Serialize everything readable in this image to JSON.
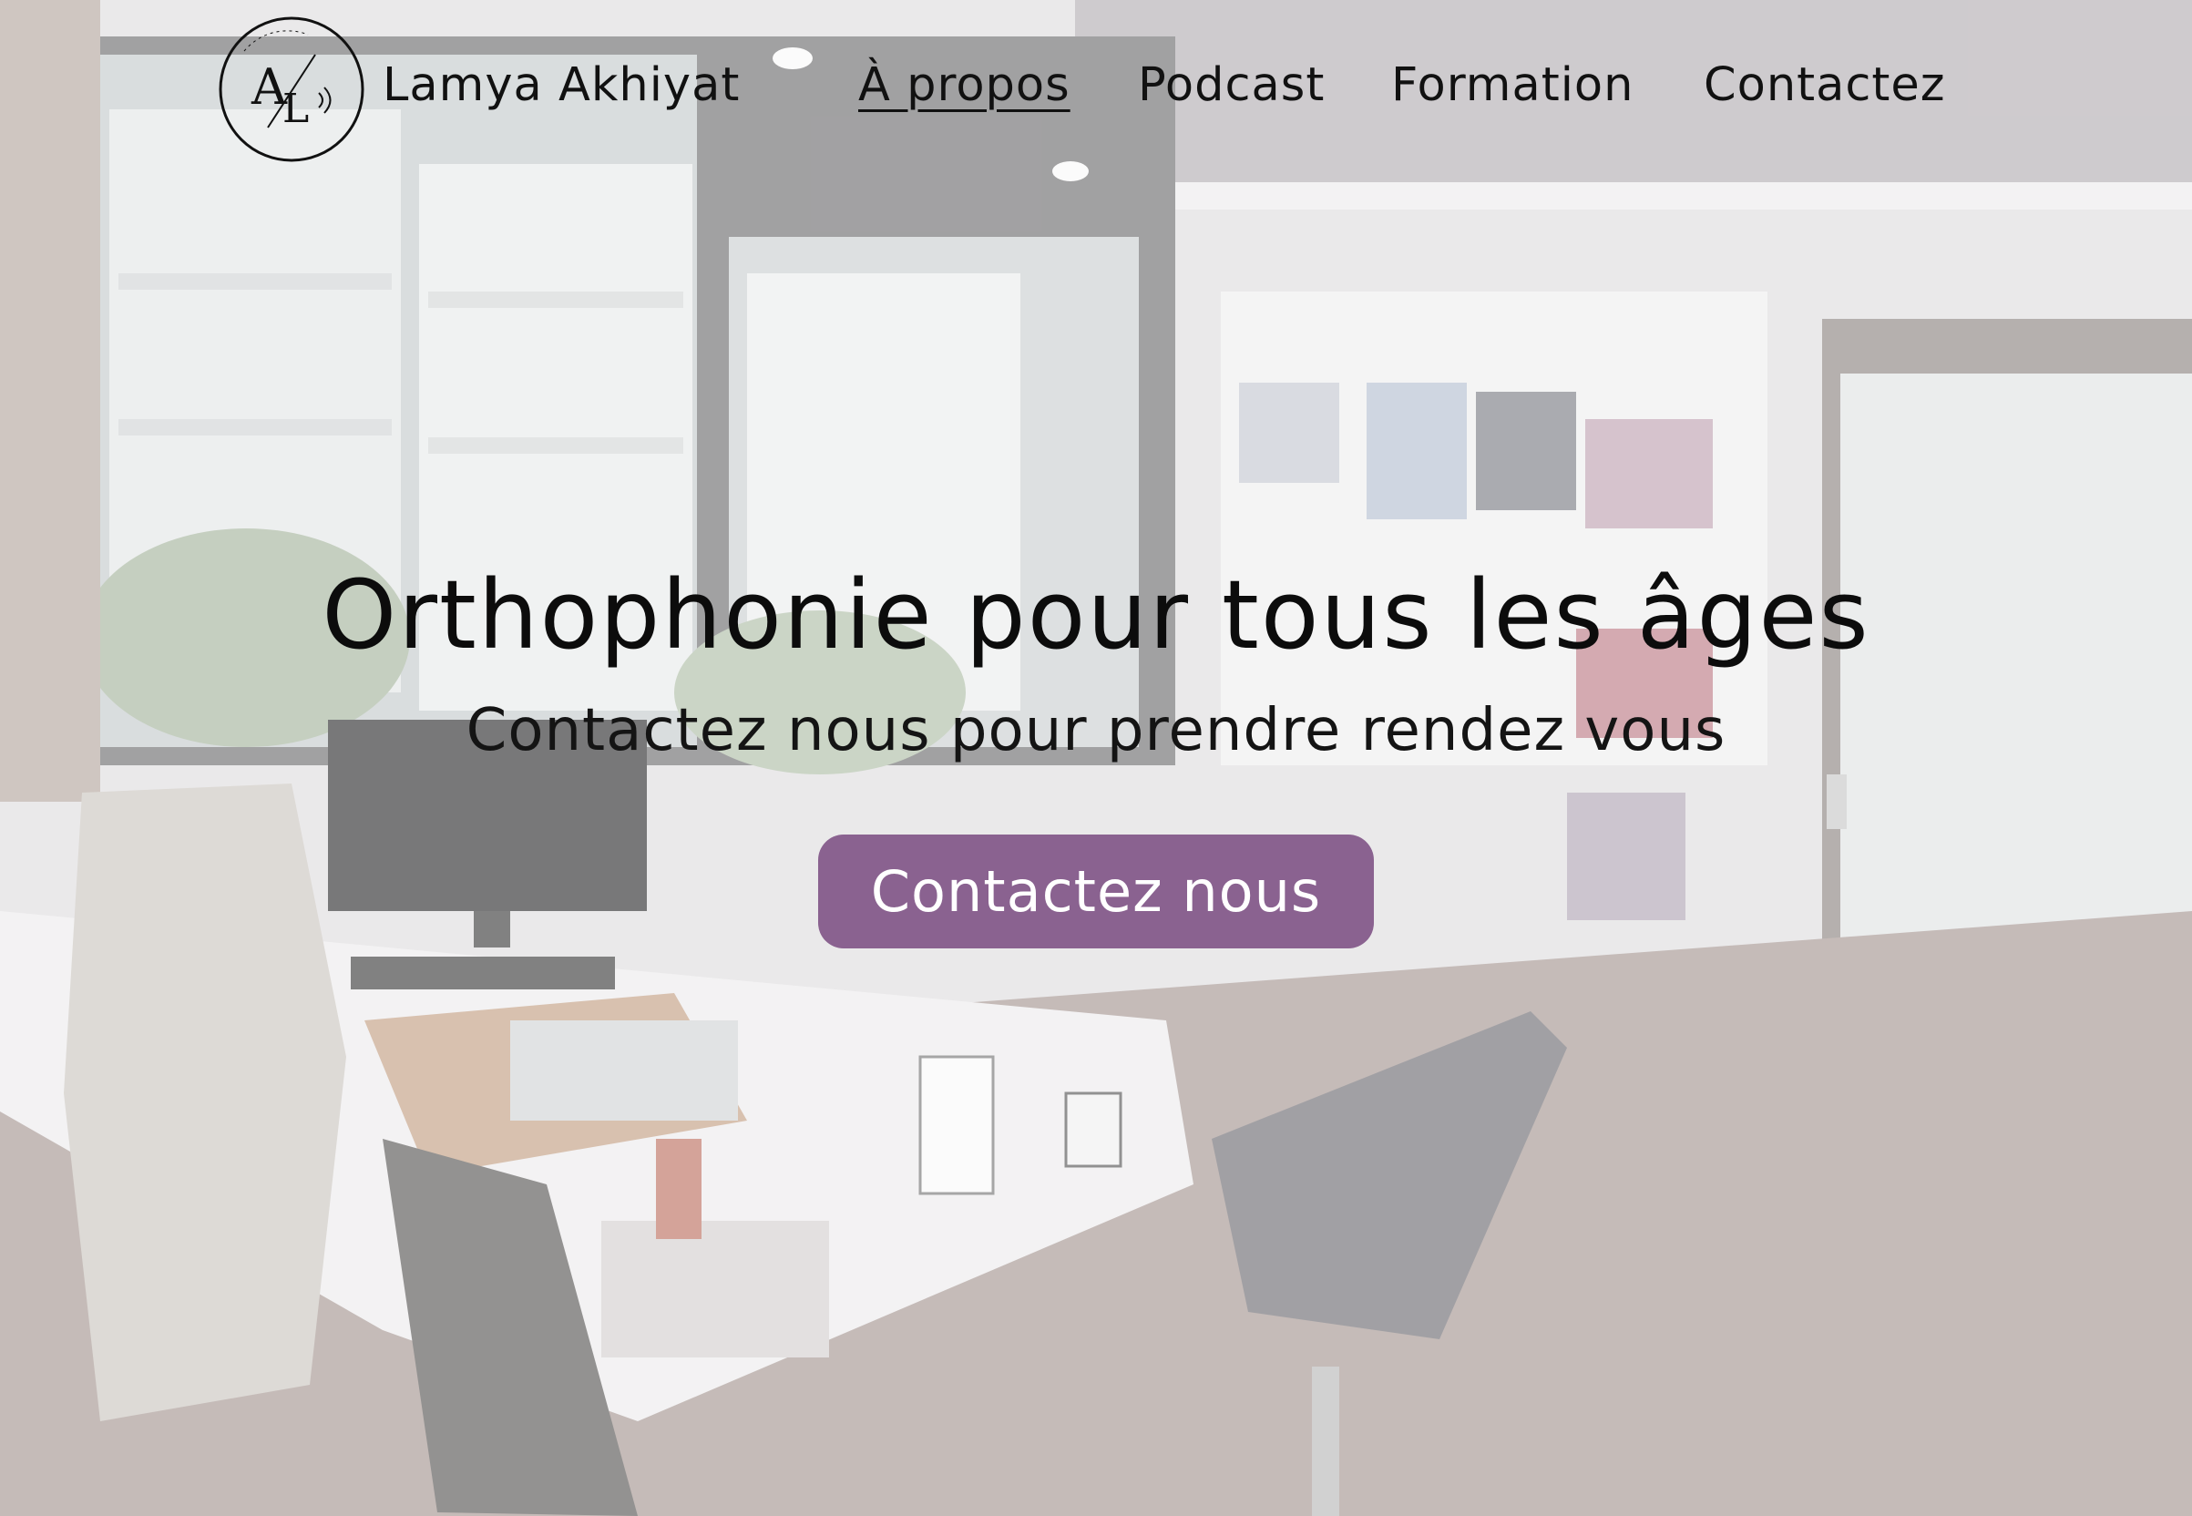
{
  "header": {
    "logo": {
      "monogram": "AL",
      "ring_text": "ORTHOPHONISTE"
    },
    "brand_name": "Lamya Akhiyat",
    "nav": [
      {
        "label": "À propos",
        "active": true
      },
      {
        "label": "Podcast",
        "active": false
      },
      {
        "label": "Formation",
        "active": false
      },
      {
        "label": "Contactez",
        "active": false
      }
    ]
  },
  "hero": {
    "title": "Orthophonie pour tous les âges",
    "subtitle": "Contactez nous pour prendre rendez vous",
    "cta_label": "Contactez nous",
    "background": "office-photo"
  },
  "colors": {
    "accent": "#8a6290",
    "text": "#111111",
    "button_text": "#ffffff"
  }
}
